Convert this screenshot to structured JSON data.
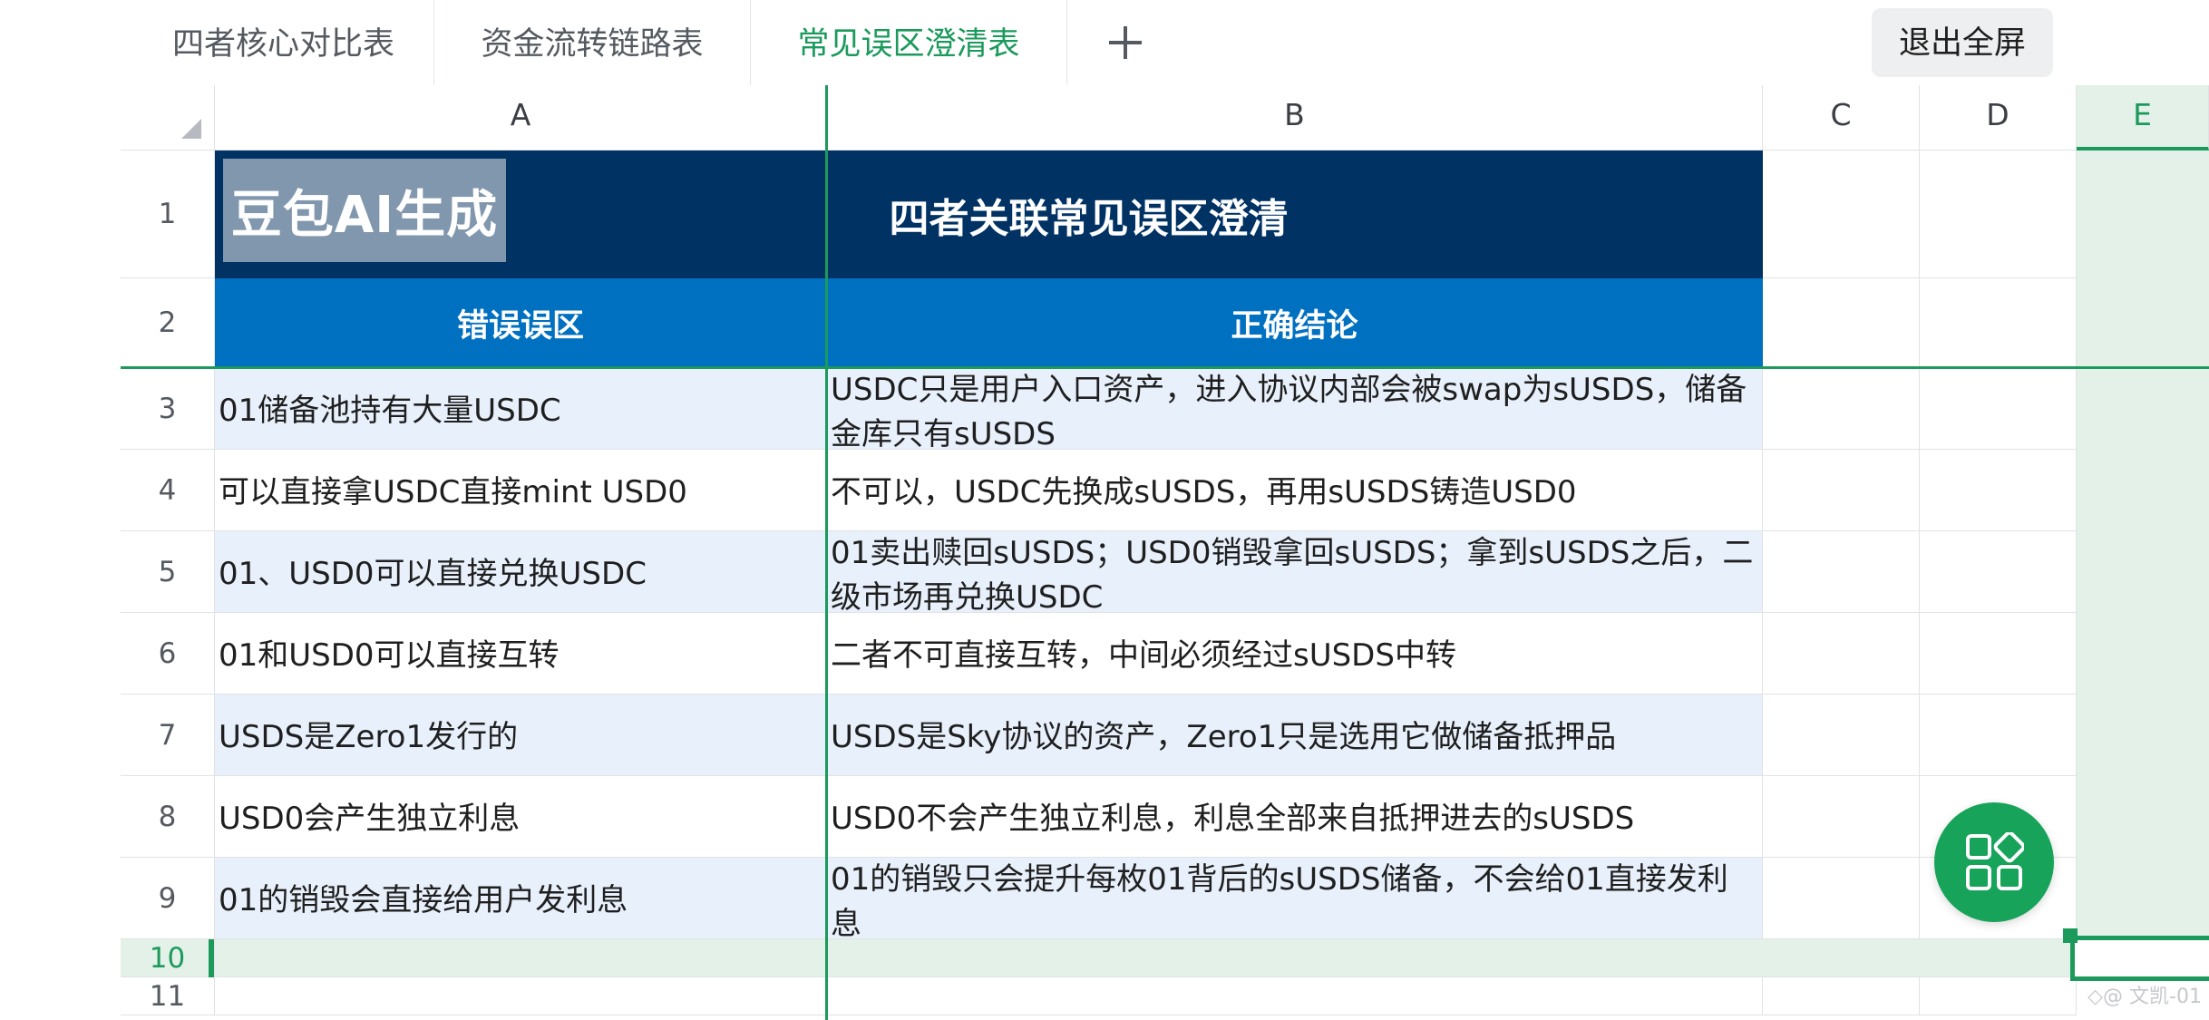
{
  "tabs": [
    {
      "label": "四者核心对比表"
    },
    {
      "label": "资金流转链路表"
    },
    {
      "label": "常见误区澄清表"
    }
  ],
  "toolbar": {
    "add_tab_icon": "plus-icon",
    "exit_fullscreen_label": "退出全屏"
  },
  "colors": {
    "accent": "#1b9a5c",
    "title_bg": "#003264",
    "header_bg": "#0070c1",
    "row_shade": "#e8f0fb"
  },
  "sheet": {
    "columns": [
      "A",
      "B",
      "C",
      "D",
      "E"
    ],
    "row_numbers": [
      "1",
      "2",
      "3",
      "4",
      "5",
      "6",
      "7",
      "8",
      "9",
      "10",
      "11"
    ],
    "watermark": "豆包AI生成",
    "title": "四者关联常见误区澄清",
    "headers": {
      "a": "错误误区",
      "b": "正确结论"
    },
    "rows": [
      {
        "a": "01储备池持有大量USDC",
        "b": "USDC只是用户入口资产，进入协议内部会被swap为sUSDS，储备金库只有sUSDS"
      },
      {
        "a": "可以直接拿USDC直接mint USD0",
        "b": "不可以，USDC先换成sUSDS，再用sUSDS铸造USD0"
      },
      {
        "a": "01、USD0可以直接兑换USDC",
        "b": "01卖出赎回sUSDS；USD0销毁拿回sUSDS；拿到sUSDS之后，二级市场再兑换USDC"
      },
      {
        "a": "01和USD0可以直接互转",
        "b": "二者不可直接互转，中间必须经过sUSDS中转"
      },
      {
        "a": "USDS是Zero1发行的",
        "b": "USDS是Sky协议的资产，Zero1只是选用它做储备抵押品"
      },
      {
        "a": "USD0会产生独立利息",
        "b": "USD0不会产生独立利息，利息全部来自抵押进去的sUSDS"
      },
      {
        "a": "01的销毁会直接给用户发利息",
        "b": "01的销毁只会提升每枚01背后的sUSDS储备，不会给01直接发利息"
      }
    ]
  },
  "fab": {
    "icon": "apps-grid-icon"
  },
  "footer": {
    "mark": "◇@ 文凯-01"
  }
}
